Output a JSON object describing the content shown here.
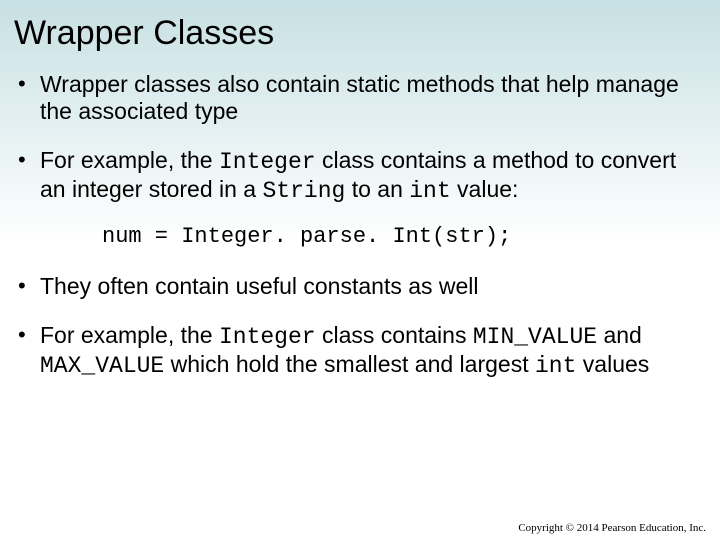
{
  "title": "Wrapper Classes",
  "bullets": {
    "b1": "Wrapper classes also contain static methods that help manage the associated type",
    "b2a": "For example, the ",
    "b2_code1": "Integer",
    "b2b": " class contains a method to convert an integer stored in a ",
    "b2_code2": "String",
    "b2c": " to an ",
    "b2_code3": "int",
    "b2d": " value:",
    "codeline": "num = Integer. parse. Int(str);",
    "b3": "They often contain useful constants as well",
    "b4a": "For example, the ",
    "b4_code1": "Integer",
    "b4b": " class contains ",
    "b4_code2": "MIN_VALUE",
    "b4c": " and ",
    "b4_code3": "MAX_VALUE",
    "b4d": " which hold the smallest and largest ",
    "b4_code4": "int",
    "b4e": " values"
  },
  "footer": "Copyright © 2014 Pearson Education, Inc."
}
